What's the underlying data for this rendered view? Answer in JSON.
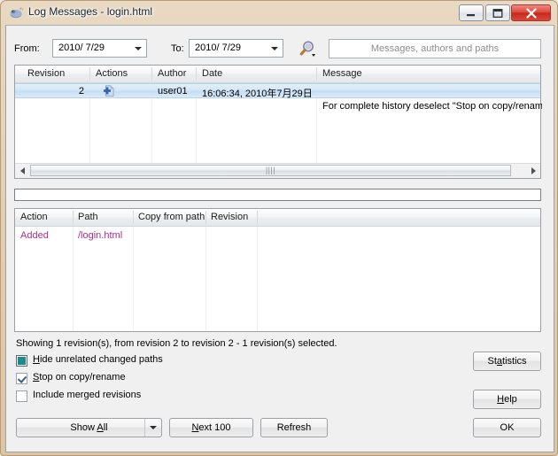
{
  "window": {
    "title": "Log Messages - login.html",
    "icon": "tortoisesvn-icon",
    "controls": {
      "minimize": "minimize-button",
      "maximize": "maximize-button",
      "close": "close-button"
    }
  },
  "filter": {
    "from_label": "From:",
    "from_value": "2010/ 7/29",
    "to_label": "To:",
    "to_value": "2010/ 7/29",
    "search_icon": "magnifier-icon",
    "search_placeholder": "Messages, authors and paths",
    "search_value": ""
  },
  "log_list": {
    "columns": [
      "Revision",
      "Actions",
      "Author",
      "Date",
      "Message"
    ],
    "rows": [
      {
        "revision": "2",
        "action_icon": "add-file-icon",
        "author": "user01",
        "date": "16:06:34, 2010年7月29日",
        "message": "",
        "selected": true
      }
    ],
    "note": "For complete history deselect \"Stop on copy/rename",
    "scrollbar": {
      "left_arrow": "scroll-left-icon",
      "right_arrow": "scroll-right-icon",
      "grip": "||||"
    }
  },
  "path_list": {
    "columns": [
      "Action",
      "Path",
      "Copy from path",
      "Revision"
    ],
    "rows": [
      {
        "action": "Added",
        "path": "/login.html",
        "copy_from_path": "",
        "revision": ""
      }
    ],
    "row_color": "#b02a8f"
  },
  "status": {
    "text": "Showing 1 revision(s), from revision 2 to revision 2 - 1 revision(s) selected."
  },
  "options": [
    {
      "label": "Hide unrelated changed paths",
      "accel": "H",
      "state": "indeterminate"
    },
    {
      "label": "Stop on copy/rename",
      "accel": "S",
      "state": "checked"
    },
    {
      "label": "Include merged revisions",
      "accel": "",
      "state": "unchecked"
    }
  ],
  "buttons": {
    "statistics": "Statistics",
    "statistics_accel": "a",
    "help": "Help",
    "help_accel": "H",
    "ok": "OK",
    "show_all": "Show All",
    "show_all_accel": "A",
    "next_100": "Next 100",
    "next_100_accel": "N",
    "refresh": "Refresh"
  },
  "colors": {
    "frame": "#e3cfb4",
    "client": "#f0f0f0",
    "selection": "#c6ddf3",
    "path_text": "#b02a8f",
    "close_button": "#c62a1c"
  }
}
